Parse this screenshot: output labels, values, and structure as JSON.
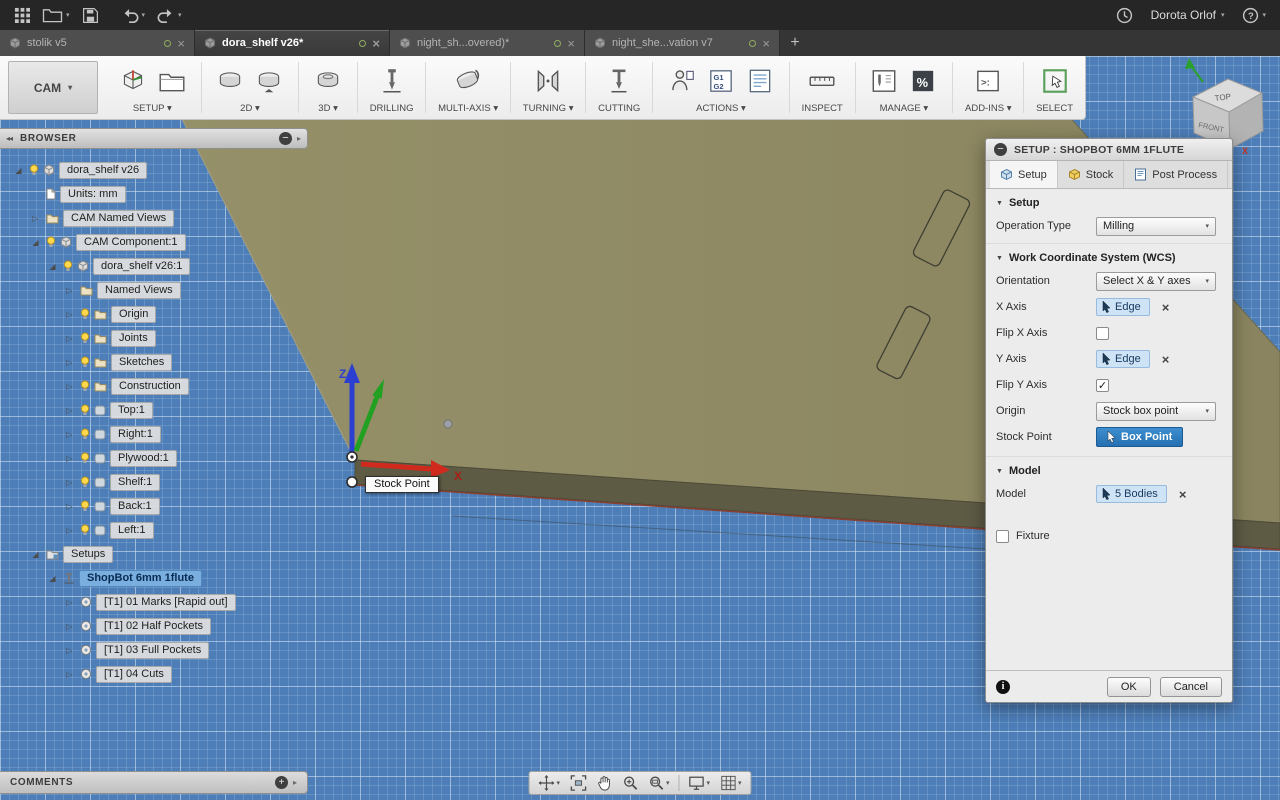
{
  "topbar": {
    "user": "Dorota Orlof",
    "help": "?"
  },
  "doc_tabs": [
    {
      "label": "stolik v5",
      "active": false
    },
    {
      "label": "dora_shelf v26*",
      "active": true
    },
    {
      "label": "night_sh...overed)*",
      "active": false
    },
    {
      "label": "night_she...vation v7",
      "active": false
    }
  ],
  "ribbon": {
    "workspace": "CAM",
    "groups": [
      {
        "label": "SETUP",
        "arrow": true,
        "icons": [
          "setup-box",
          "setup-folder"
        ]
      },
      {
        "label": "2D",
        "arrow": true,
        "icons": [
          "coin",
          "coin2"
        ]
      },
      {
        "label": "3D",
        "arrow": true,
        "icons": [
          "coin3"
        ]
      },
      {
        "label": "DRILLING",
        "arrow": false,
        "icons": [
          "drill"
        ]
      },
      {
        "label": "MULTI-AXIS",
        "arrow": true,
        "icons": [
          "multiaxis"
        ]
      },
      {
        "label": "TURNING",
        "arrow": true,
        "icons": [
          "turning"
        ]
      },
      {
        "label": "CUTTING",
        "arrow": false,
        "icons": [
          "cutting"
        ]
      },
      {
        "label": "ACTIONS",
        "arrow": true,
        "icons": [
          "person",
          "gcode",
          "sheet"
        ]
      },
      {
        "label": "INSPECT",
        "arrow": false,
        "icons": [
          "ruler"
        ]
      },
      {
        "label": "MANAGE",
        "arrow": true,
        "icons": [
          "toollib",
          "percent"
        ]
      },
      {
        "label": "ADD-INS",
        "arrow": true,
        "icons": [
          "addins"
        ]
      },
      {
        "label": "SELECT",
        "arrow": false,
        "icons": [
          "select"
        ]
      }
    ]
  },
  "browser": {
    "title": "BROWSER",
    "items": [
      {
        "label": "dora_shelf v26",
        "indent": 0,
        "expand": "open",
        "bulb": true,
        "icon": "component"
      },
      {
        "label": "Units: mm",
        "indent": 1,
        "expand": "none",
        "bulb": false,
        "icon": "doc"
      },
      {
        "label": "CAM Named Views",
        "indent": 1,
        "expand": "closed",
        "bulb": false,
        "icon": "folder"
      },
      {
        "label": "CAM Component:1",
        "indent": 1,
        "expand": "open",
        "bulb": true,
        "icon": "component"
      },
      {
        "label": "dora_shelf v26:1",
        "indent": 2,
        "expand": "open",
        "bulb": true,
        "icon": "component"
      },
      {
        "label": "Named Views",
        "indent": 3,
        "expand": "closed",
        "bulb": false,
        "icon": "folder"
      },
      {
        "label": "Origin",
        "indent": 3,
        "expand": "closed",
        "bulb": true,
        "icon": "folder"
      },
      {
        "label": "Joints",
        "indent": 3,
        "expand": "closed",
        "bulb": true,
        "icon": "folder"
      },
      {
        "label": "Sketches",
        "indent": 3,
        "expand": "closed",
        "bulb": true,
        "icon": "folder"
      },
      {
        "label": "Construction",
        "indent": 3,
        "expand": "closed",
        "bulb": true,
        "icon": "folder"
      },
      {
        "label": "Top:1",
        "indent": 3,
        "expand": "closed",
        "bulb": true,
        "icon": "body"
      },
      {
        "label": "Right:1",
        "indent": 3,
        "expand": "closed",
        "bulb": true,
        "icon": "body"
      },
      {
        "label": "Plywood:1",
        "indent": 3,
        "expand": "closed",
        "bulb": true,
        "icon": "body"
      },
      {
        "label": "Shelf:1",
        "indent": 3,
        "expand": "closed",
        "bulb": true,
        "icon": "body"
      },
      {
        "label": "Back:1",
        "indent": 3,
        "expand": "closed",
        "bulb": true,
        "icon": "body"
      },
      {
        "label": "Left:1",
        "indent": 3,
        "expand": "closed",
        "bulb": true,
        "icon": "body"
      },
      {
        "label": "Setups",
        "indent": 1,
        "expand": "open",
        "bulb": false,
        "icon": "setups-folder"
      },
      {
        "label": "ShopBot 6mm 1flute",
        "indent": 2,
        "expand": "open",
        "bulb": false,
        "icon": "setup",
        "selected": true
      },
      {
        "label": "[T1] 01 Marks [Rapid out]",
        "indent": 3,
        "expand": "closed",
        "bulb": false,
        "icon": "operation"
      },
      {
        "label": "[T1] 02 Half Pockets",
        "indent": 3,
        "expand": "closed",
        "bulb": false,
        "icon": "operation"
      },
      {
        "label": "[T1] 03 Full Pockets",
        "indent": 3,
        "expand": "closed",
        "bulb": false,
        "icon": "operation"
      },
      {
        "label": "[T1] 04 Cuts",
        "indent": 3,
        "expand": "closed",
        "bulb": false,
        "icon": "operation"
      }
    ]
  },
  "viewport": {
    "tooltip": "Stock Point",
    "axes": {
      "x": "X",
      "z": "Z"
    },
    "viewcube": {
      "top": "TOP",
      "front": "FRONT",
      "x": "X"
    }
  },
  "dialog": {
    "title": "SETUP : SHOPBOT 6MM 1FLUTE",
    "tabs": [
      {
        "label": "Setup",
        "active": true
      },
      {
        "label": "Stock",
        "active": false
      },
      {
        "label": "Post Process",
        "active": false
      }
    ],
    "sections": {
      "setup": "Setup",
      "wcs": "Work Coordinate System (WCS)",
      "model": "Model"
    },
    "rows": {
      "operation_type": {
        "label": "Operation Type",
        "value": "Milling"
      },
      "orientation": {
        "label": "Orientation",
        "value": "Select X & Y axes"
      },
      "x_axis": {
        "label": "X Axis",
        "value": "Edge"
      },
      "flip_x": {
        "label": "Flip X Axis",
        "checked": false
      },
      "y_axis": {
        "label": "Y Axis",
        "value": "Edge"
      },
      "flip_y": {
        "label": "Flip Y Axis",
        "checked": true
      },
      "origin": {
        "label": "Origin",
        "value": "Stock box point"
      },
      "stock_point": {
        "label": "Stock Point",
        "value": "Box Point"
      },
      "model": {
        "label": "Model",
        "value": "5 Bodies"
      },
      "fixture": {
        "label": "Fixture",
        "checked": false
      }
    },
    "ok": "OK",
    "cancel": "Cancel"
  },
  "comments": {
    "title": "COMMENTS"
  }
}
